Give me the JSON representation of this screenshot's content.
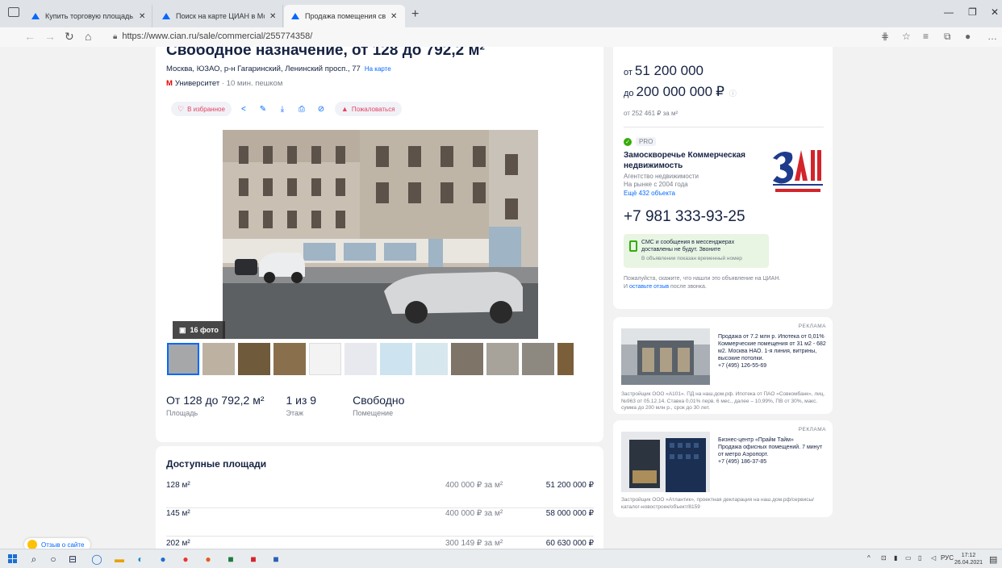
{
  "browser": {
    "tabs": [
      {
        "title": "Купить торговую площадь, пом"
      },
      {
        "title": "Поиск на карте ЦИАН в Моск"
      },
      {
        "title": "Продажа помещения свободн"
      }
    ],
    "url": "https://www.cian.ru/sale/commercial/255774358/"
  },
  "listing": {
    "title": "Свободное назначение, от 128 до 792,2 м²",
    "address": "Москва, ЮЗАО, р-н Гагаринский, Ленинский просп., 77",
    "map_link": "На карте",
    "metro": "Университет",
    "metro_walk": "· 10 мин. пешком",
    "actions": {
      "favorite": "В избранное",
      "complain": "Пожаловаться"
    },
    "photo_count": "16 фото",
    "facts": [
      {
        "value": "От 128 до 792,2 м²",
        "label": "Площадь"
      },
      {
        "value": "1 из 9",
        "label": "Этаж"
      },
      {
        "value": "Свободно",
        "label": "Помещение"
      }
    ],
    "available_title": "Доступные площади",
    "available": [
      {
        "area": "128 м²",
        "per_m": "400 000 ₽ за м²",
        "total": "51 200 000 ₽"
      },
      {
        "area": "145 м²",
        "per_m": "400 000 ₽ за м²",
        "total": "58 000 000 ₽"
      },
      {
        "area": "202 м²",
        "per_m": "300 149 ₽ за м²",
        "total": "60 630 000 ₽"
      }
    ]
  },
  "price": {
    "from_prefix": "от",
    "from_value": "51 200 000",
    "to_prefix": "до",
    "to_value": "200 000 000",
    "currency": "₽",
    "per_meter": "от 252 461 ₽ за м²"
  },
  "agency": {
    "badge": "PRO",
    "name": "Замоскворечье Коммерческая недвижимость",
    "type": "Агентство недвижимости",
    "since": "На рынке с 2004 года",
    "more": "Ещё 432 объекта",
    "phone": "+7 981 333-93-25",
    "sms_note": "СМС и сообщения в мессенджерах доставлены не будут. Звоните",
    "temp_number": "В объявлении показан временный номер",
    "please": "Пожалуйста, скажите, что нашли это объявление на ЦИАН. И",
    "feedback_link": "оставьте отзыв",
    "please_tail": "после звонка."
  },
  "ads": [
    {
      "tag": "РЕКЛАМА",
      "title": "Продажа от 7.2 млн р. Ипотека от 0,01%",
      "text": "Коммерческие помещения от 31 м2 - 682 м2. Москва НАО. 1-я линия, витрины, высокие потолки.",
      "phone": "+7 (495) 126-55-69",
      "foot": "Застройщик ООО «А101». ПД на наш.дом.рф. Ипотека от ПАО «Совкомбанк», лиц. №963 от 05.12.14. Ставка 0,01% перв. 6 мес., далее – 10,99%, ПВ от 30%, макс. сумма до 200 млн р., срок до 30 лет."
    },
    {
      "tag": "РЕКЛАМА",
      "title": "Бизнес-центр «Прайм Тайм»",
      "text": "Продажа офисных помещений. 7 минут от метро Аэропорт.",
      "phone": "+7 (495) 186-37-85",
      "foot": "Застройщик ООО «Атлантик», проектная декларация на наш.дом.рф/сервисы/каталог-новостроек/объект/8159"
    }
  ],
  "feedback_button": "Отзыв о сайте",
  "taskbar": {
    "lang": "РУС",
    "time": "17:12",
    "date": "26.04.2021"
  },
  "colors": {
    "accent": "#0468ff",
    "heart": "#e84260",
    "metro": "#e60000",
    "pro_green": "#34ac0a"
  }
}
